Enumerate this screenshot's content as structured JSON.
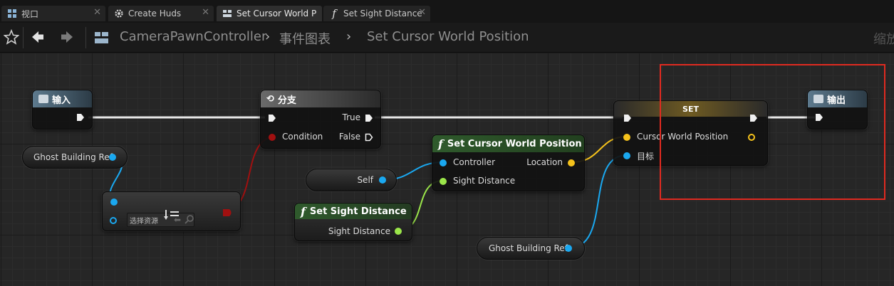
{
  "tabs": [
    {
      "label": "视口",
      "icon": "viewport-icon"
    },
    {
      "label": "Create Huds",
      "icon": "gear-icon"
    },
    {
      "label": "Set Cursor World P",
      "icon": "blueprint-graph-icon"
    },
    {
      "label": "Set Sight Distance",
      "icon": "function-icon"
    }
  ],
  "breadcrumb": {
    "blueprint": "CameraPawnController",
    "graph": "事件图表",
    "function": "Set Cursor World Position",
    "zoom": "缩放"
  },
  "nodes": {
    "entry": {
      "title": "输入"
    },
    "branch": {
      "title": "分支",
      "true_label": "True",
      "condition_label": "Condition",
      "false_label": "False"
    },
    "set_cursor": {
      "title": "Set Cursor World Position",
      "controller_label": "Controller",
      "sight_label": "Sight Distance",
      "location_label": "Location"
    },
    "set_sight": {
      "title": "Set Sight Distance",
      "sight_label": "Sight Distance"
    },
    "self_node": {
      "label": "Self"
    },
    "ghost_ref_1": {
      "label": "Ghost Building Ref"
    },
    "ghost_ref_2": {
      "label": "Ghost Building Ref"
    },
    "is_valid": {
      "asset_placeholder": "选择资源"
    },
    "set_var": {
      "title": "SET",
      "cursor_label": "Cursor World Position",
      "target_label": "目标"
    },
    "return": {
      "title": "输出"
    }
  },
  "colors": {
    "object_pin": "#1aa8f0",
    "vector_pin": "#f5c21b",
    "float_pin": "#9be64a",
    "bool_pin": "#a01010",
    "function_header": "#2f5a2c",
    "entry_header": "#5d7a8e",
    "highlight_box": "#e02a20"
  }
}
